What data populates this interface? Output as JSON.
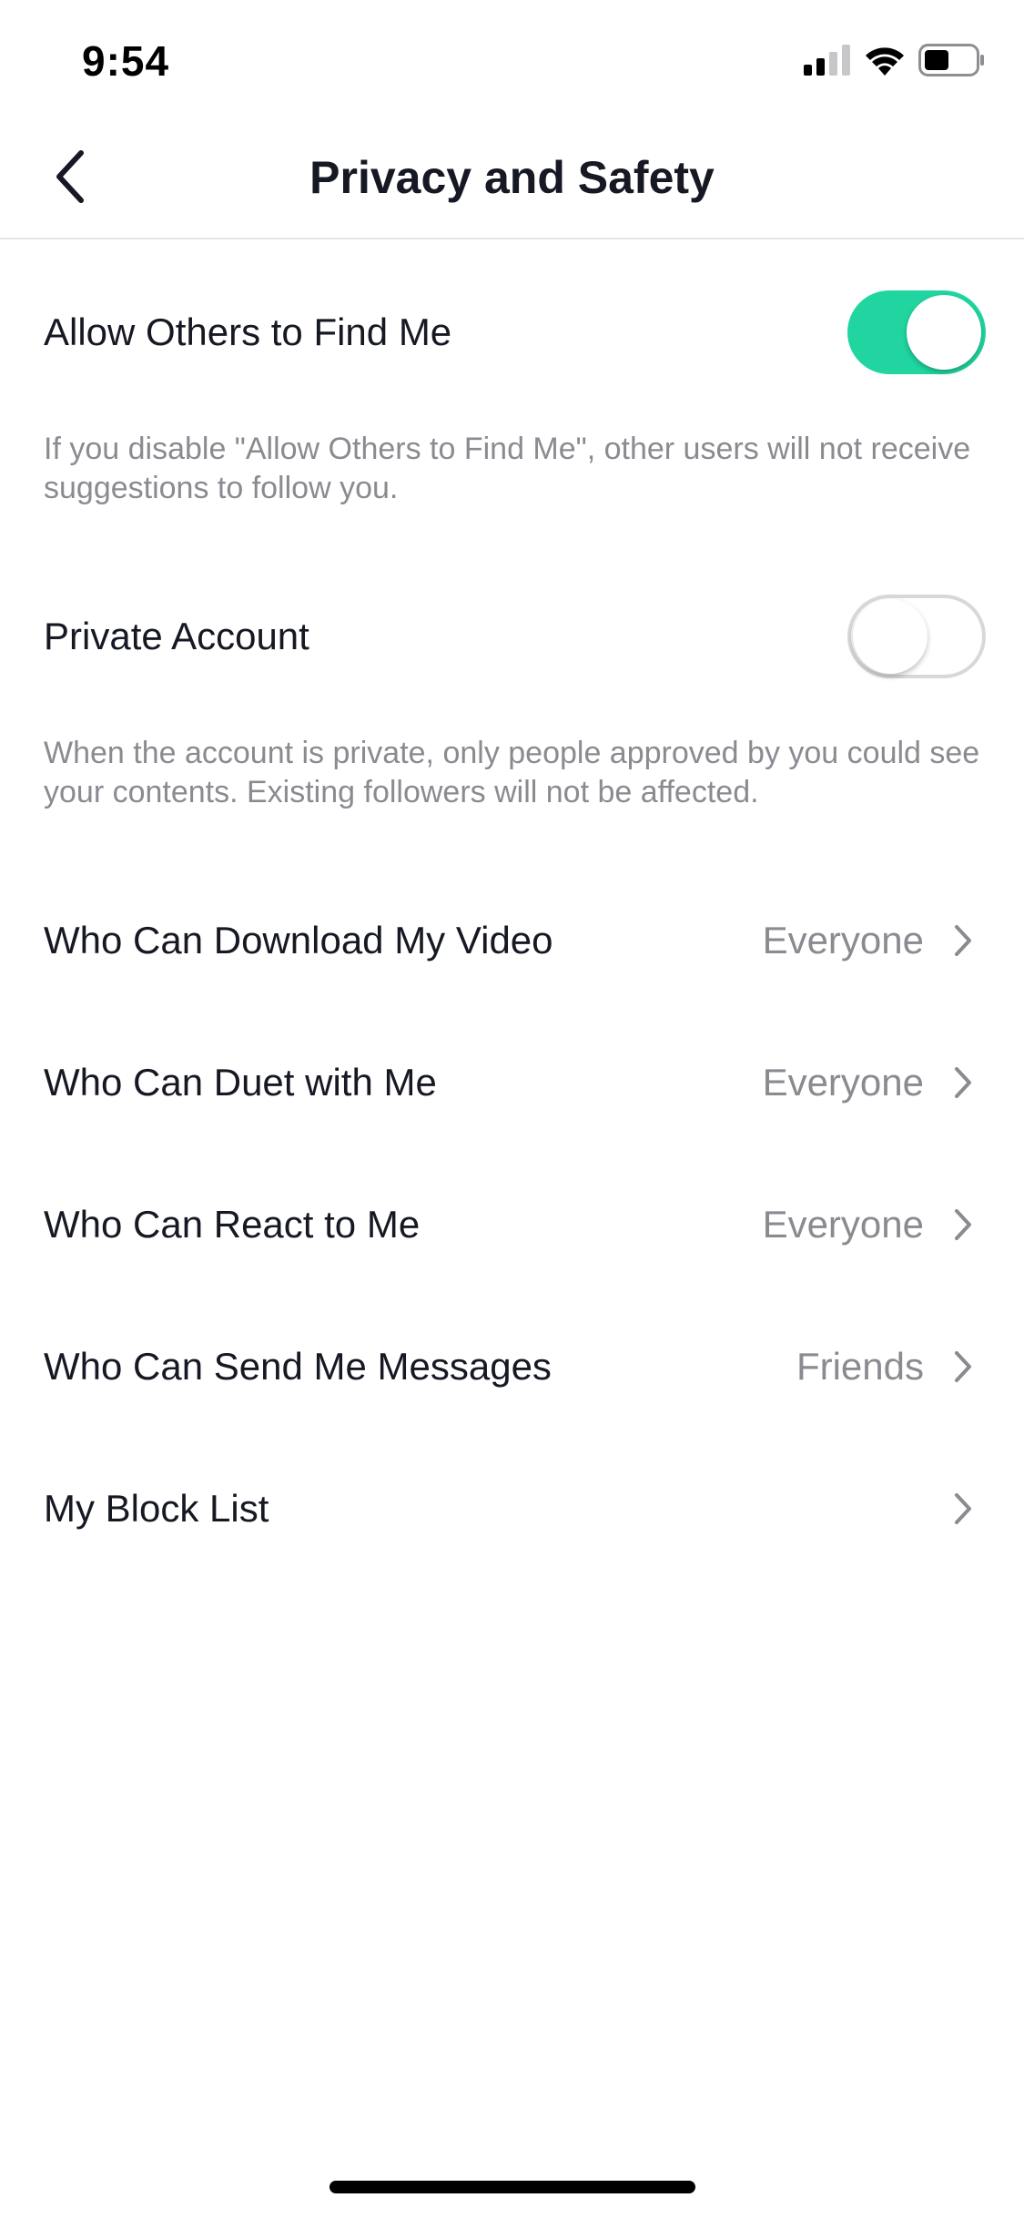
{
  "status_bar": {
    "time": "9:54",
    "icons": [
      "cellular-signal-icon",
      "wifi-icon",
      "battery-icon"
    ]
  },
  "nav": {
    "back_icon": "chevron-left-icon",
    "title": "Privacy and Safety"
  },
  "settings": {
    "allow_find": {
      "label": "Allow Others to Find Me",
      "enabled": true,
      "description": "If you disable \"Allow Others to Find Me\", other users will not receive suggestions to follow you."
    },
    "private_account": {
      "label": "Private Account",
      "enabled": false,
      "description": "When the account is private, only people approved by you could see your contents. Existing followers will not be affected."
    },
    "items": [
      {
        "label": "Who Can Download My Video",
        "value": "Everyone"
      },
      {
        "label": "Who Can Duet with Me",
        "value": "Everyone"
      },
      {
        "label": "Who Can React to Me",
        "value": "Everyone"
      },
      {
        "label": "Who Can Send Me Messages",
        "value": "Friends"
      },
      {
        "label": "My Block List",
        "value": ""
      }
    ]
  },
  "colors": {
    "toggle_on": "#20d5a0",
    "text_primary": "#161823",
    "text_secondary": "#8a8b91"
  }
}
